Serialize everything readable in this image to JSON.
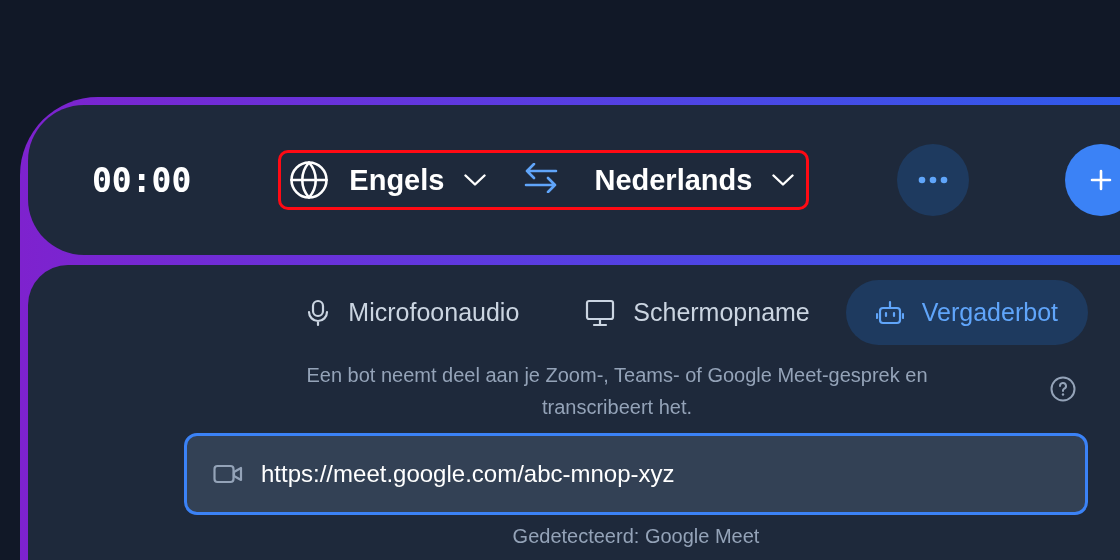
{
  "timer": "00:00",
  "languages": {
    "source": "Engels",
    "target": "Nederlands",
    "highlighted": true
  },
  "tabs": [
    {
      "kind": "microphone",
      "label": "Microfoonaudio",
      "selected": false
    },
    {
      "kind": "screen",
      "label": "Schermopname",
      "selected": false
    },
    {
      "kind": "bot",
      "label": "Vergaderbot",
      "selected": true
    }
  ],
  "description": "Een bot neemt deel aan je Zoom-, Teams- of Google Meet-gesprek en transcribeert het.",
  "meeting_link": {
    "value": "https://meet.google.com/abc-mnop-xyz"
  },
  "detected": "Gedetecteerd: Google Meet"
}
